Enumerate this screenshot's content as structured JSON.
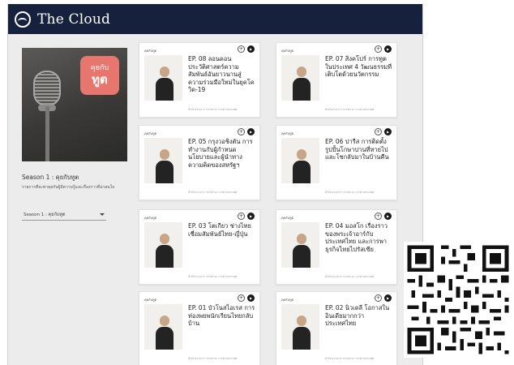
{
  "header": {
    "site_title": "The Cloud",
    "logo_icon": "cloud-circle-icon"
  },
  "hero": {
    "badge_line1": "คุยกับ",
    "badge_line2": "ทูต"
  },
  "sidebar": {
    "season_title": "Season 1 : คุยกับทูต",
    "season_description": "รายการที่จะพาคุยกับผู้มีความรู้และเรื่องราวที่น่าสนใจ",
    "season_select_value": "Season 1 : คุยกับทูต"
  },
  "episodes": [
    {
      "category": "คุยกับทูต",
      "title": "EP. 08 ลอนดอน ประวัติศาสตร์ความสัมพันธ์อันยาวนานสู่ความร่วมมือใหม่ในยุคโควิด-19",
      "meta": "สำนักงานการ กระทรวง การต่างประเทศ"
    },
    {
      "category": "คุยกับทูต",
      "title": "EP. 07 สิงคโปร์ การทูตในประเทศ 4 วัฒนธรรมที่เติบโตด้วยนวัตกรรม",
      "meta": "สำนักงานการ กระทรวง การต่างประเทศ"
    },
    {
      "category": "คุยกับทูต",
      "title": "EP. 05 กรุงวอชิงตัน การทำงานกับผู้กำหนดนโยบายและผู้นำทางความคิดของสหรัฐฯ",
      "meta": "สำนักงานการ กระทรวง การต่างประเทศ"
    },
    {
      "category": "คุยกับทูต",
      "title": "EP. 06 ปารีส การติดตั้งรูปปั้นโกษาปานที่หายไป และโชกลับมาในบ้านคืน",
      "meta": "สำนักงานการ กระทรวง การต่างประเทศ"
    },
    {
      "category": "คุยกับทูต",
      "title": "EP. 03 โตเกียว ช่างไทยเชื่อมสัมพันธ์ไทย-ญี่ปุ่น",
      "meta": "สำนักงานการ กระทรวง การต่างประเทศ"
    },
    {
      "category": "คุยกับทูต",
      "title": "EP. 04 มอสโก เรื่องราวของพระเจ้าอาร์กับประเทศไทย และการพาธุรกิจไทยไปรัสเซีย",
      "meta": "สำนักงานการ กระทรวง การต่างประเทศ"
    },
    {
      "category": "คุยกับทูต",
      "title": "EP. 01 บัวโนสไอเรส การท่องพยพนักเรียนไทยกลับบ้าน",
      "meta": "สำนักงานการ กระทรวง การต่างประเทศ"
    },
    {
      "category": "คุยกับทูต",
      "title": "EP. 02 นิวเดลี โอกาสในอินเดียมากกว่าประเทศไทย",
      "meta": "สำนักงานการ กระทรวง การต่างประเทศ"
    }
  ],
  "icons": {
    "add": "plus-circle-icon",
    "play": "play-circle-icon"
  }
}
